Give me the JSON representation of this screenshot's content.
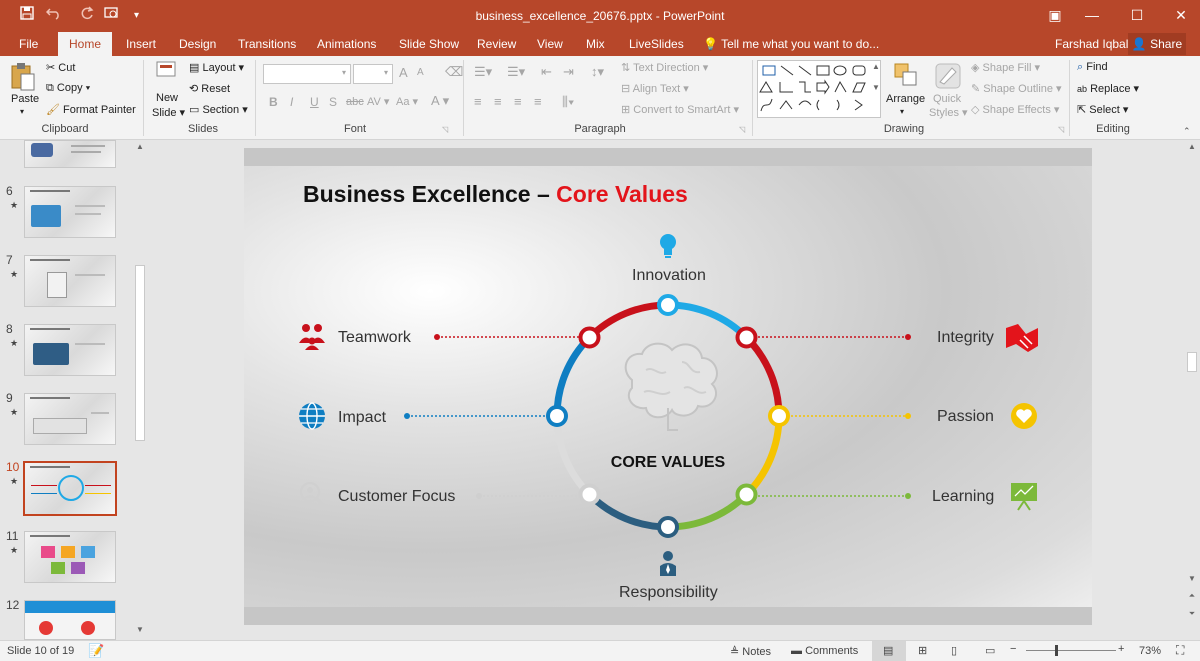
{
  "window": {
    "doc_title": "business_excellence_20676.pptx - PowerPoint",
    "quick_access": {
      "save": "save-icon",
      "undo": "undo-icon",
      "redo": "redo-icon",
      "present": "present-icon",
      "customize": "customize-icon"
    },
    "controls": {
      "ribbon_display": "▣",
      "minimize": "—",
      "maximize": "☐",
      "close": "✕"
    }
  },
  "tabs": [
    "File",
    "Home",
    "Insert",
    "Design",
    "Transitions",
    "Animations",
    "Slide Show",
    "Review",
    "View",
    "Mix",
    "LiveSlides"
  ],
  "active_tab": "Home",
  "tell_me": "Tell me what you want to do...",
  "user_name": "Farshad Iqbal",
  "share_label": "Share",
  "ribbon": {
    "clipboard": {
      "paste": "Paste",
      "cut": "Cut",
      "copy": "Copy",
      "format_painter": "Format Painter",
      "group": "Clipboard"
    },
    "slides": {
      "new_slide": "New",
      "new_slide2": "Slide",
      "layout": "Layout",
      "reset": "Reset",
      "section": "Section",
      "group": "Slides"
    },
    "font": {
      "group": "Font",
      "bold": "B",
      "italic": "I",
      "underline": "U",
      "shadow": "S",
      "strike": "abc",
      "spacing": "AV",
      "case": "Aa",
      "grow": "A",
      "shrink": "A"
    },
    "paragraph": {
      "text_direction": "Text Direction",
      "align_text": "Align Text",
      "convert_smartart": "Convert to SmartArt",
      "group": "Paragraph"
    },
    "drawing": {
      "arrange": "Arrange",
      "quick_styles": "Quick",
      "quick_styles2": "Styles",
      "shape_fill": "Shape Fill",
      "shape_outline": "Shape Outline",
      "shape_effects": "Shape Effects",
      "group": "Drawing"
    },
    "editing": {
      "find": "Find",
      "replace": "Replace",
      "select": "Select",
      "group": "Editing"
    }
  },
  "thumbnails": [
    {
      "num": "6",
      "star": "★"
    },
    {
      "num": "7",
      "star": "★"
    },
    {
      "num": "8",
      "star": "★"
    },
    {
      "num": "9",
      "star": "★"
    },
    {
      "num": "10",
      "star": "★"
    },
    {
      "num": "11",
      "star": "★"
    },
    {
      "num": "12",
      "star": ""
    }
  ],
  "selected_slide": "10",
  "slide": {
    "title_black": "Business Excellence – ",
    "title_red": "Core Values",
    "center_label": "CORE VALUES",
    "values": {
      "innovation": "Innovation",
      "teamwork": "Teamwork",
      "integrity": "Integrity",
      "impact": "Impact",
      "passion": "Passion",
      "customer_focus": "Customer Focus",
      "learning": "Learning",
      "responsibility": "Responsibility"
    },
    "colors": {
      "red": "#c8111b",
      "blue": "#0f7ec2",
      "sky": "#1fa9e6",
      "yellow": "#f5c400",
      "green": "#7cb93a",
      "gray": "#c9c9c9",
      "navy": "#2c5e80"
    }
  },
  "status": {
    "slide_of": "Slide 10 of 19",
    "notes": "Notes",
    "comments": "Comments",
    "zoom": "73%"
  }
}
